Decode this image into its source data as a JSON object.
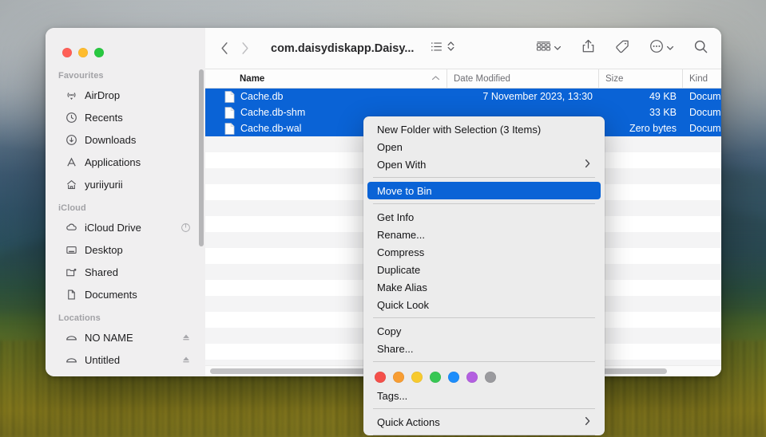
{
  "window": {
    "title": "com.daisydiskapp.Daisy...",
    "traffic_lights": [
      "close-button",
      "minimise-button",
      "zoom-button"
    ]
  },
  "toolbar": {
    "back_label": "‹",
    "forward_label": "›",
    "view_icon": "list-view-icon",
    "view_chevron": "updown-chevron-icon",
    "group_icon": "group-by-icon",
    "group_chevron": "chevron-down-icon",
    "share_icon": "share-icon",
    "tag_icon": "tag-icon",
    "more_icon": "ellipsis-circle-icon",
    "more_chevron": "chevron-down-icon",
    "search_icon": "search-icon"
  },
  "sidebar": {
    "sections": [
      {
        "title": "Favourites",
        "items": [
          {
            "label": "AirDrop",
            "icon": "airdrop-icon"
          },
          {
            "label": "Recents",
            "icon": "clock-icon"
          },
          {
            "label": "Downloads",
            "icon": "download-icon"
          },
          {
            "label": "Applications",
            "icon": "applications-icon"
          },
          {
            "label": "yuriiyurii",
            "icon": "home-icon"
          }
        ]
      },
      {
        "title": "iCloud",
        "items": [
          {
            "label": "iCloud Drive",
            "icon": "cloud-icon",
            "trailing": "sync-progress-icon"
          },
          {
            "label": "Desktop",
            "icon": "desktop-icon"
          },
          {
            "label": "Shared",
            "icon": "shared-folder-icon"
          },
          {
            "label": "Documents",
            "icon": "document-icon"
          }
        ]
      },
      {
        "title": "Locations",
        "items": [
          {
            "label": "NO NAME",
            "icon": "drive-icon",
            "trailing": "eject-icon"
          },
          {
            "label": "Untitled",
            "icon": "drive-icon",
            "trailing": "eject-icon"
          }
        ]
      }
    ]
  },
  "file_list": {
    "columns": [
      {
        "key": "name",
        "label": "Name",
        "sort": "ascending",
        "sort_icon": "chevron-up-icon"
      },
      {
        "key": "date",
        "label": "Date Modified"
      },
      {
        "key": "size",
        "label": "Size"
      },
      {
        "key": "kind",
        "label": "Kind"
      }
    ],
    "rows": [
      {
        "name": "Cache.db",
        "date": "7 November 2023, 13:30",
        "size": "49 KB",
        "kind": "Docum",
        "selected": true,
        "icon": "document-file-icon"
      },
      {
        "name": "Cache.db-shm",
        "date": "",
        "size": "33 KB",
        "kind": "Docum",
        "selected": true,
        "icon": "document-file-icon"
      },
      {
        "name": "Cache.db-wal",
        "date": "",
        "size": "Zero bytes",
        "kind": "Docum",
        "selected": true,
        "icon": "document-file-icon"
      }
    ],
    "empty_row_count": 15
  },
  "context_menu": {
    "groups": [
      {
        "items": [
          {
            "label": "New Folder with Selection (3 Items)"
          },
          {
            "label": "Open"
          },
          {
            "label": "Open With",
            "submenu": "›"
          }
        ]
      },
      {
        "items": [
          {
            "label": "Move to Bin",
            "highlighted": true
          }
        ]
      },
      {
        "items": [
          {
            "label": "Get Info"
          },
          {
            "label": "Rename..."
          },
          {
            "label": "Compress"
          },
          {
            "label": "Duplicate"
          },
          {
            "label": "Make Alias"
          },
          {
            "label": "Quick Look"
          }
        ]
      },
      {
        "items": [
          {
            "label": "Copy"
          },
          {
            "label": "Share..."
          }
        ]
      },
      {
        "tags": {
          "colors": [
            "#f4504a",
            "#f79d33",
            "#f7ca2e",
            "#38c754",
            "#1d8dfb",
            "#b35fe0",
            "#9a9a9e"
          ],
          "names": [
            "red-tag",
            "orange-tag",
            "yellow-tag",
            "green-tag",
            "blue-tag",
            "purple-tag",
            "grey-tag"
          ]
        },
        "items": [
          {
            "label": "Tags..."
          }
        ]
      },
      {
        "items": [
          {
            "label": "Quick Actions",
            "submenu": "›"
          }
        ]
      }
    ]
  },
  "colors": {
    "selection_blue": "#0a63d6",
    "menu_background": "#ececec",
    "sidebar_background": "#f0eff0",
    "row_stripe": "#f4f4f5"
  }
}
